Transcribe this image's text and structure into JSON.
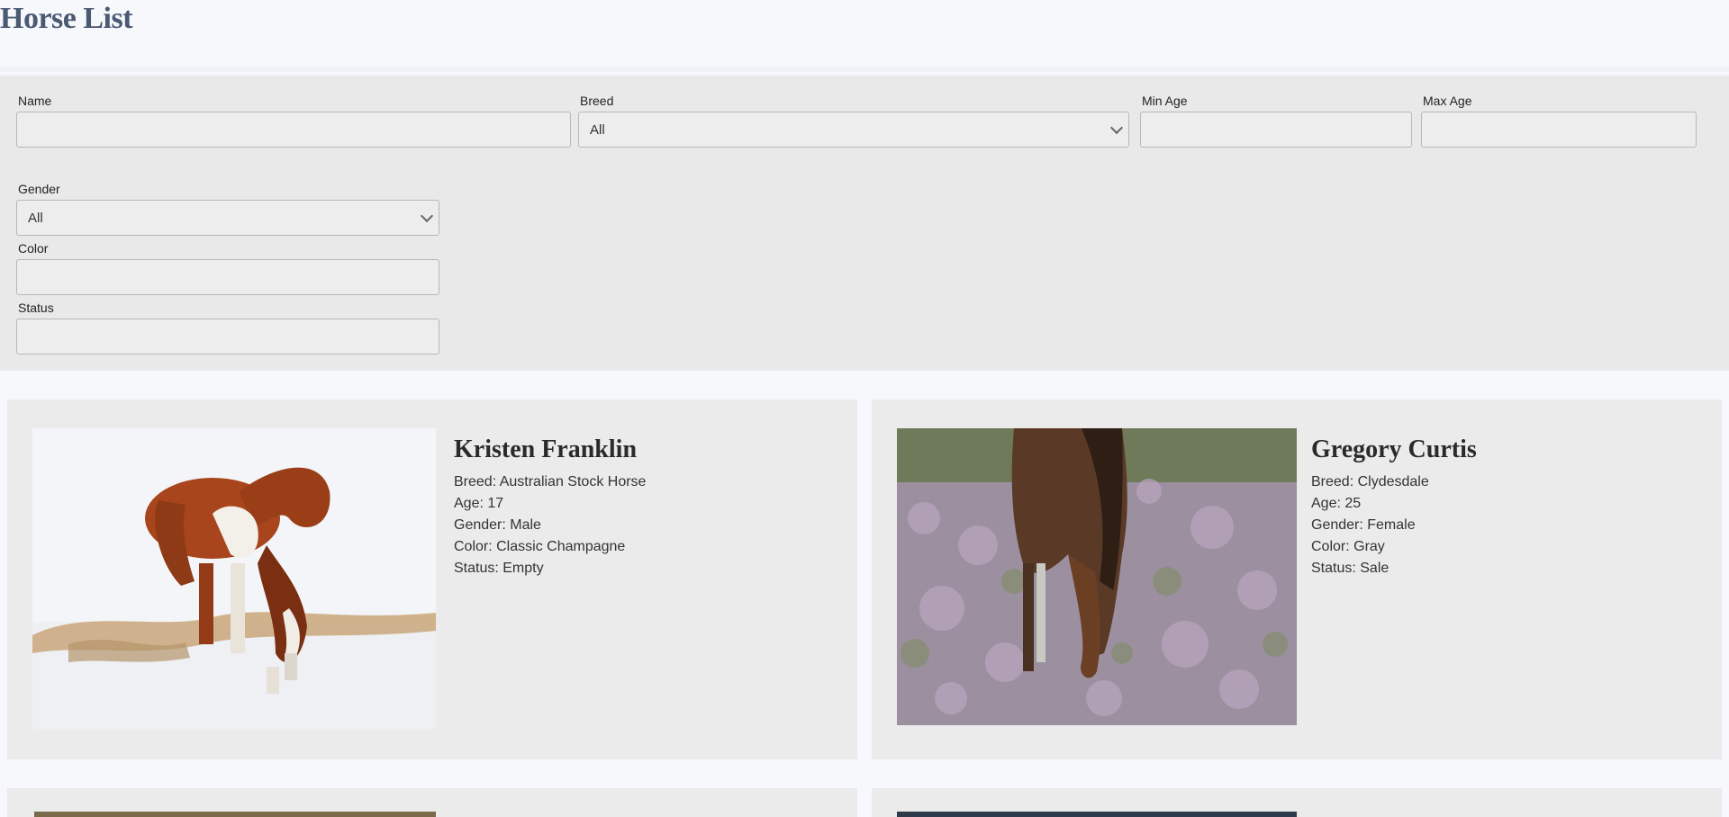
{
  "page": {
    "title": "Horse List"
  },
  "filters": {
    "name": {
      "label": "Name",
      "value": ""
    },
    "breed": {
      "label": "Breed",
      "value": "All"
    },
    "min_age": {
      "label": "Min Age",
      "value": ""
    },
    "max_age": {
      "label": "Max Age",
      "value": ""
    },
    "gender": {
      "label": "Gender",
      "value": "All"
    },
    "color": {
      "label": "Color",
      "value": ""
    },
    "status": {
      "label": "Status",
      "value": ""
    }
  },
  "horses": [
    {
      "name": "Kristen Franklin",
      "breed": "Breed: Australian Stock Horse",
      "age": "Age: 17",
      "gender": "Gender: Male",
      "color": "Color: Classic Champagne",
      "status": "Status: Empty"
    },
    {
      "name": "Gregory Curtis",
      "breed": "Breed: Clydesdale",
      "age": "Age: 25",
      "gender": "Gender: Female",
      "color": "Color: Gray",
      "status": "Status: Sale"
    }
  ]
}
